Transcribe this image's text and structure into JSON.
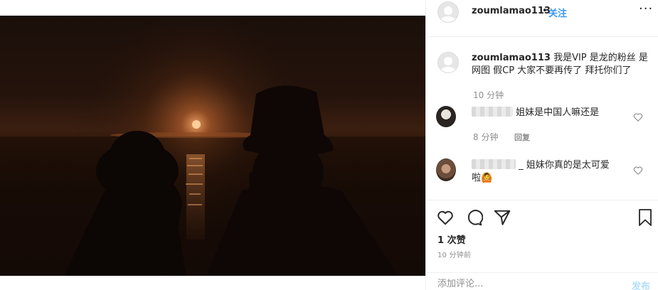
{
  "post": {
    "author": "zoumlamao113",
    "dot": "•",
    "follow_label": "关注",
    "more_label": "···"
  },
  "caption": {
    "username": "zoumlamao113",
    "text_line1": "我是VIP 是龙的粉丝 是",
    "text_line2": "网图 假CP 大家不要再传了 拜托你们了",
    "time": "10 分钟"
  },
  "comments": [
    {
      "text": "姐妹是中国人嘛还是",
      "time": "8 分钟",
      "reply_label": "回复"
    },
    {
      "text_line1": "_ 姐妹你真的是太可爱",
      "text_line2": "啦🙆"
    }
  ],
  "actions": {
    "likes": "1 次赞",
    "time_ago": "10 分钟前"
  },
  "add_comment": {
    "placeholder": "添加评论...",
    "post_label": "发布"
  },
  "icons": {
    "header_avatar": "default-avatar-icon",
    "like": "heart-icon",
    "comment": "comment-bubble-icon",
    "share": "paper-plane-icon",
    "save": "bookmark-icon"
  },
  "colors": {
    "accent": "#3897f0",
    "post_disabled": "#b2dffc",
    "muted": "#8e8e8e"
  }
}
